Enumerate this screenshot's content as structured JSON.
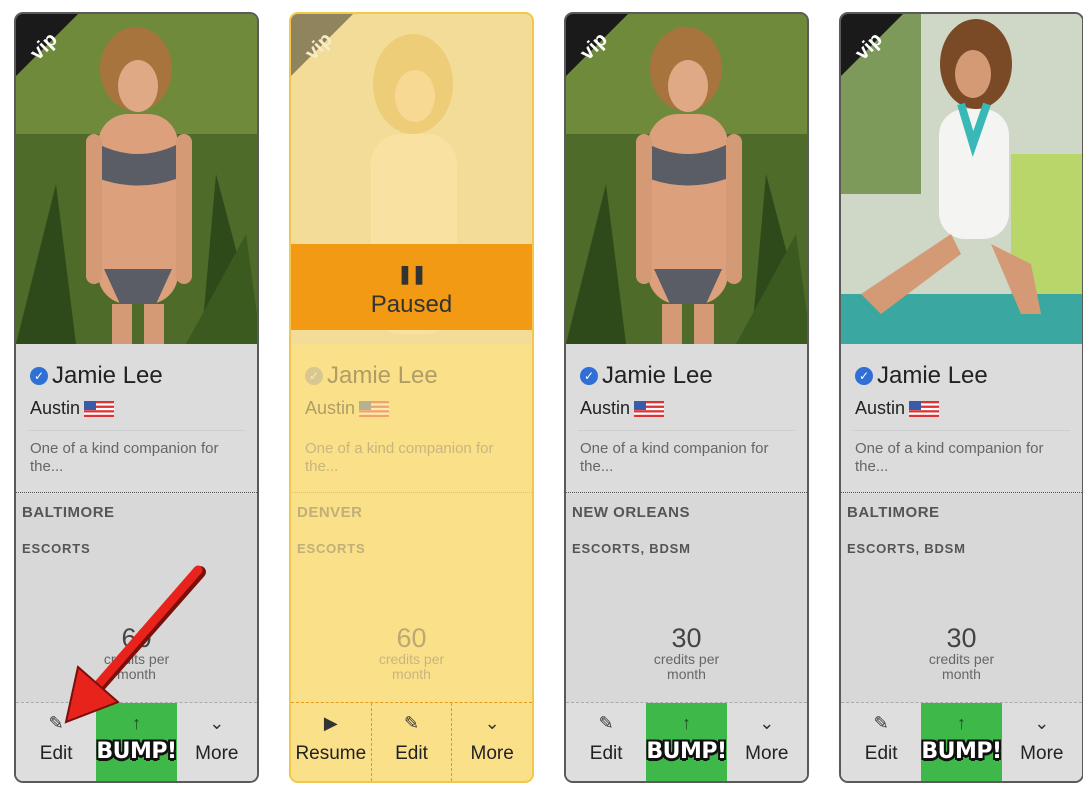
{
  "cards": [
    {
      "name": "Jamie Lee",
      "city": "Austin",
      "description": "One of a kind companion for the...",
      "location": "BALTIMORE",
      "tags": "ESCORTS",
      "credits_value": "60",
      "credits_label": "credits per month",
      "vip_label": "vip",
      "actions": [
        {
          "icon": "edit-icon",
          "label": "Edit"
        },
        {
          "icon": "bump-arrow-icon",
          "label": "BUMP!"
        },
        {
          "icon": "chevron-down-icon",
          "label": "More"
        }
      ]
    },
    {
      "name": "Jamie Lee",
      "city": "Austin",
      "description": "One of a kind companion for the...",
      "location": "DENVER",
      "tags": "ESCORTS",
      "credits_value": "60",
      "credits_label": "credits per month",
      "vip_label": "vip",
      "status": "Paused",
      "actions": [
        {
          "icon": "play-icon",
          "label": "Resume"
        },
        {
          "icon": "edit-icon",
          "label": "Edit"
        },
        {
          "icon": "chevron-down-icon",
          "label": "More"
        }
      ]
    },
    {
      "name": "Jamie Lee",
      "city": "Austin",
      "description": "One of a kind companion for the...",
      "location": "NEW ORLEANS",
      "tags": "ESCORTS, BDSM",
      "credits_value": "30",
      "credits_label": "credits per month",
      "vip_label": "vip",
      "actions": [
        {
          "icon": "edit-icon",
          "label": "Edit"
        },
        {
          "icon": "bump-arrow-icon",
          "label": "BUMP!"
        },
        {
          "icon": "chevron-down-icon",
          "label": "More"
        }
      ]
    },
    {
      "name": "Jamie Lee",
      "city": "Austin",
      "description": "One of a kind companion for the...",
      "location": "BALTIMORE",
      "tags": "ESCORTS, BDSM",
      "credits_value": "30",
      "credits_label": "credits per month",
      "vip_label": "vip",
      "actions": [
        {
          "icon": "edit-icon",
          "label": "Edit"
        },
        {
          "icon": "bump-arrow-icon",
          "label": "BUMP!"
        },
        {
          "icon": "chevron-down-icon",
          "label": "More"
        }
      ]
    }
  ],
  "colors": {
    "bump_green": "#3fb84a",
    "paused_orange": "#f29a14",
    "paused_card_bg": "#fbe08a",
    "verified_blue": "#2f6fd6",
    "annotation_arrow": "#e8231b"
  }
}
